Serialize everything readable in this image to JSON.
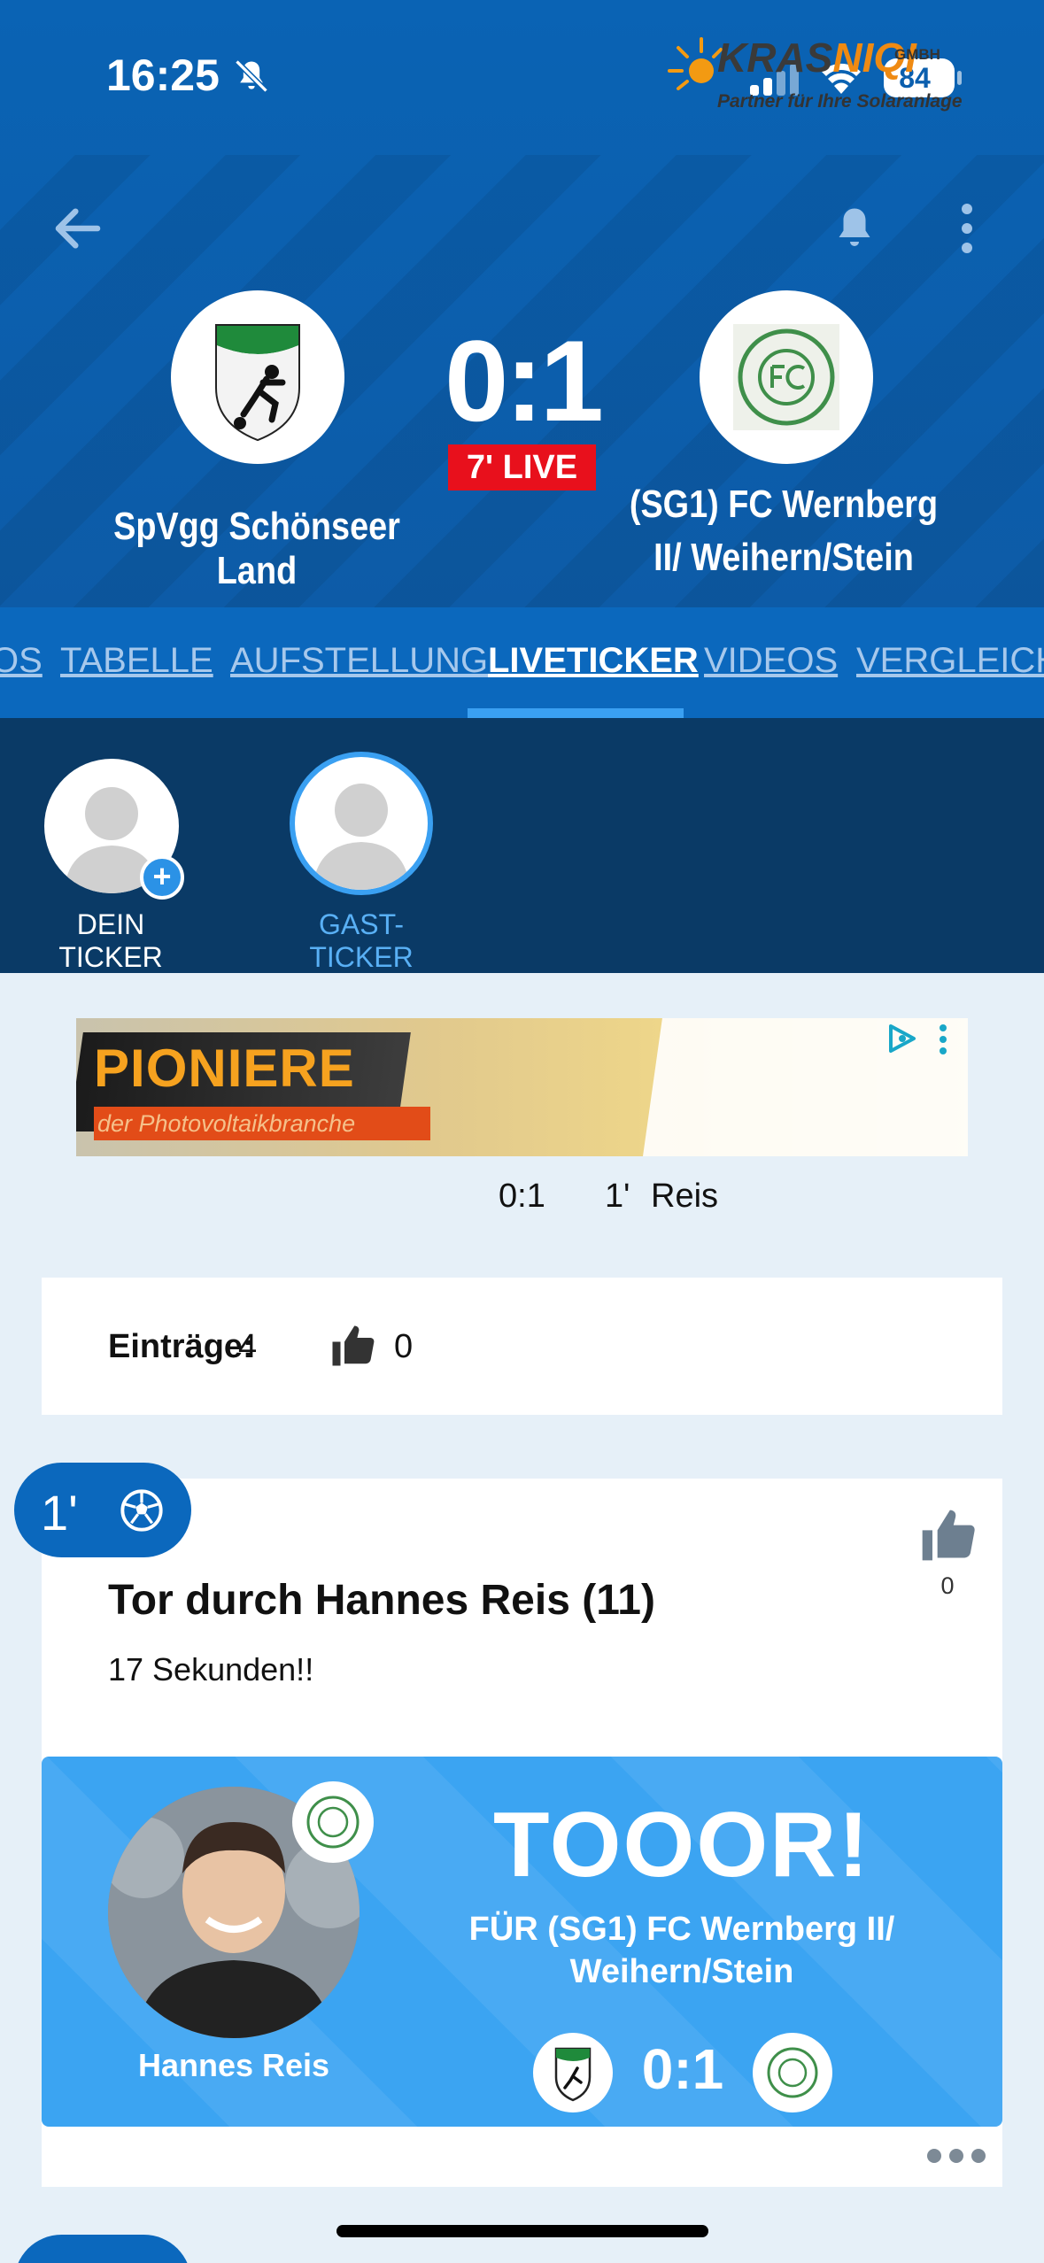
{
  "status_bar": {
    "time": "16:25",
    "battery": "84"
  },
  "match": {
    "home_team": "SpVgg Schönseer Land",
    "away_team": "(SG1) FC Wernberg II/ Weihern/Stein",
    "score": "0:1",
    "live_label": "7' LIVE"
  },
  "tabs": [
    {
      "label": "OS"
    },
    {
      "label": "TABELLE"
    },
    {
      "label": "AUFSTELLUNG"
    },
    {
      "label": "LIVETICKER"
    },
    {
      "label": "VIDEOS"
    },
    {
      "label": "VERGLEICH"
    }
  ],
  "active_tab": "LIVETICKER",
  "tickers": [
    {
      "label": "DEIN TICKER"
    },
    {
      "label": "GAST-TICKER"
    }
  ],
  "ad": {
    "headline": "PIONIERE",
    "subline": "der Photovoltaikbranche",
    "brand_a": "KRAS",
    "brand_b": "NIQI",
    "brand_suffix": "GMBH",
    "tagline": "Partner für Ihre Solaranlage"
  },
  "last_event": {
    "score": "0:1",
    "minute": "1'",
    "player": "Reis"
  },
  "stats": {
    "entries_label": "Einträge:",
    "entries": "4",
    "likes": "0"
  },
  "event": {
    "minute": "1'",
    "likes": "0",
    "title": "Tor durch Hannes Reis (11)",
    "text": "17 Sekunden!!",
    "goal": {
      "headline": "TOOOR!",
      "for_team": "FÜR (SG1) FC Wernberg II/ Weihern/Stein",
      "player": "Hannes Reis",
      "score": "0:1"
    }
  },
  "colors": {
    "header_blue": "#0a63b4",
    "tab_bar": "#0b68bd",
    "ticker_bar": "#0a3a66",
    "accent": "#3aa0f2",
    "live_red": "#e8101c",
    "goal_blue": "#3ba4f2"
  },
  "icons": [
    "bell-off-icon",
    "signal-icon",
    "wifi-icon",
    "battery-icon",
    "back-arrow-icon",
    "bell-icon",
    "more-vertical-icon",
    "plus-icon",
    "thumbs-up-icon",
    "soccer-ball-icon",
    "ad-choices-icon",
    "more-horizontal-icon"
  ]
}
